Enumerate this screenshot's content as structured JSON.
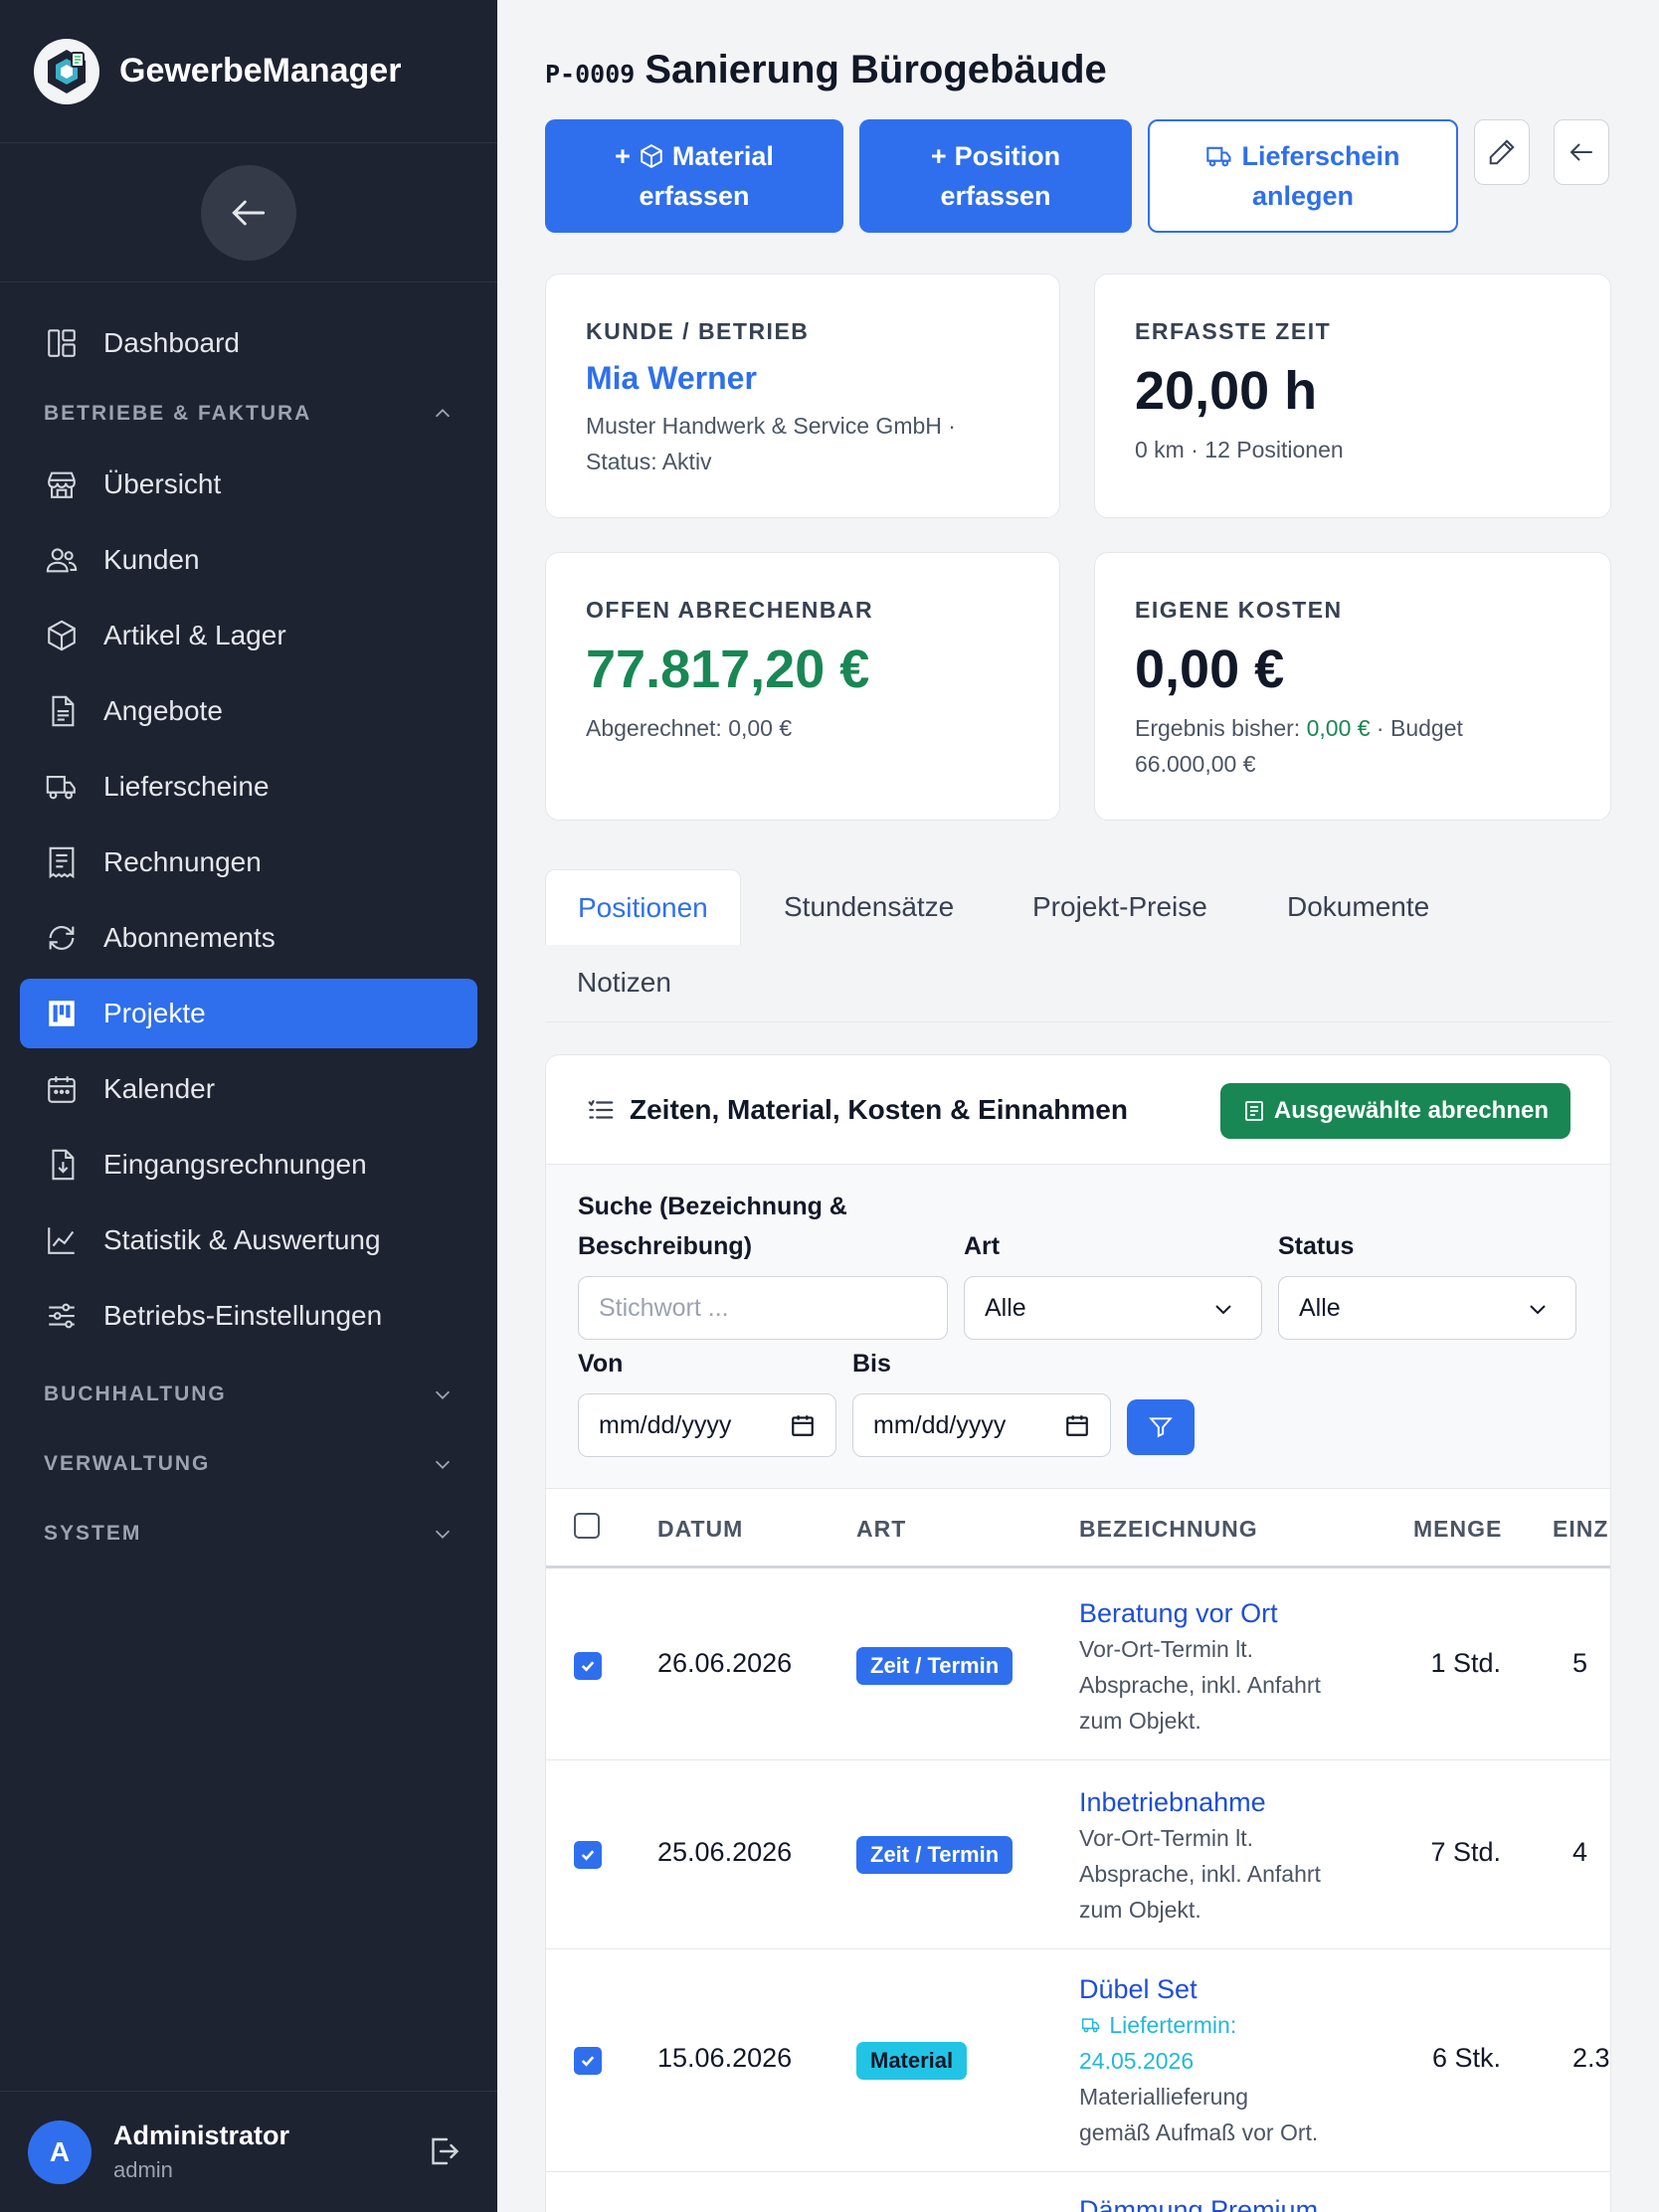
{
  "app": {
    "name": "GewerbeManager"
  },
  "sidebar": {
    "items_top": [
      {
        "label": "Dashboard",
        "icon": "dashboard-icon"
      }
    ],
    "section_betriebe": "BETRIEBE & FAKTURA",
    "items": [
      {
        "label": "Übersicht",
        "icon": "store-icon"
      },
      {
        "label": "Kunden",
        "icon": "users-icon"
      },
      {
        "label": "Artikel & Lager",
        "icon": "box-icon"
      },
      {
        "label": "Angebote",
        "icon": "document-icon"
      },
      {
        "label": "Lieferscheine",
        "icon": "truck-icon"
      },
      {
        "label": "Rechnungen",
        "icon": "invoice-icon"
      },
      {
        "label": "Abonnements",
        "icon": "refresh-icon"
      },
      {
        "label": "Projekte",
        "icon": "kanban-icon",
        "active": true
      },
      {
        "label": "Kalender",
        "icon": "calendar-icon"
      },
      {
        "label": "Eingangsrechnungen",
        "icon": "download-document-icon"
      },
      {
        "label": "Statistik & Auswertung",
        "icon": "chart-icon"
      },
      {
        "label": "Betriebs-Einstellungen",
        "icon": "sliders-icon"
      }
    ],
    "sections_collapsed": [
      "BUCHHALTUNG",
      "VERWALTUNG",
      "SYSTEM"
    ],
    "user": {
      "initial": "A",
      "name": "Administrator",
      "role": "admin"
    }
  },
  "project": {
    "code": "P-0009",
    "title": "Sanierung Bürogebäude"
  },
  "actions": {
    "material": [
      "Material",
      "erfassen"
    ],
    "position": [
      "Position",
      "erfassen"
    ],
    "lieferschein": [
      "Lieferschein",
      "anlegen"
    ]
  },
  "cards": {
    "kunde": {
      "label": "KUNDE / BETRIEB",
      "name": "Mia Werner",
      "line1": "Muster Handwerk & Service GmbH ·",
      "line2": "Status: Aktiv"
    },
    "zeit": {
      "label": "ERFASSTE ZEIT",
      "value": "20,00 h",
      "sub": "0 km · 12 Positionen"
    },
    "offen": {
      "label": "OFFEN ABRECHENBAR",
      "value": "77.817,20 €",
      "sub": "Abgerechnet: 0,00 €"
    },
    "kosten": {
      "label": "EIGENE KOSTEN",
      "value": "0,00 €",
      "sub_prefix": "Ergebnis bisher: ",
      "sub_result": "0,00 €",
      "sub_suffix": " · Budget",
      "sub_line2": "66.000,00 €"
    }
  },
  "tabs": [
    "Positionen",
    "Stundensätze",
    "Projekt-Preise",
    "Dokumente",
    "Notizen"
  ],
  "panel": {
    "title": "Zeiten, Material, Kosten & Einnahmen",
    "bill_button": "Ausgewählte abrechnen",
    "filters": {
      "search_label_1": "Suche (Bezeichnung &",
      "search_label_2": "Beschreibung)",
      "search_placeholder": "Stichwort ...",
      "art_label": "Art",
      "art_value": "Alle",
      "status_label": "Status",
      "status_value": "Alle",
      "von_label": "Von",
      "von_value": "mm/dd/yyyy",
      "bis_label": "Bis",
      "bis_value": "mm/dd/yyyy"
    },
    "columns": [
      "DATUM",
      "ART",
      "BEZEICHNUNG",
      "MENGE",
      "EINZ"
    ],
    "rows": [
      {
        "date": "26.06.2026",
        "type": "Zeit / Termin",
        "title": "Beratung vor Ort",
        "desc": [
          "Vor-Ort-Termin lt.",
          "Absprache, inkl. Anfahrt",
          "zum Objekt."
        ],
        "qty": "1 Std.",
        "price": "5"
      },
      {
        "date": "25.06.2026",
        "type": "Zeit / Termin",
        "title": "Inbetriebnahme",
        "desc": [
          "Vor-Ort-Termin lt.",
          "Absprache, inkl. Anfahrt",
          "zum Objekt."
        ],
        "qty": "7 Std.",
        "price": "4"
      },
      {
        "date": "15.06.2026",
        "type": "Material",
        "title": "Dübel Set",
        "delivery": [
          "Liefertermin:",
          "24.05.2026"
        ],
        "desc": [
          "Materiallieferung",
          "gemäß Aufmaß vor Ort."
        ],
        "qty": "6 Stk.",
        "price": "2.3"
      },
      {
        "title": "Dämmung Premium"
      }
    ]
  },
  "colors": {
    "accent": "#2f6fed",
    "success": "#198754",
    "sidebar_bg": "#1e2332"
  }
}
